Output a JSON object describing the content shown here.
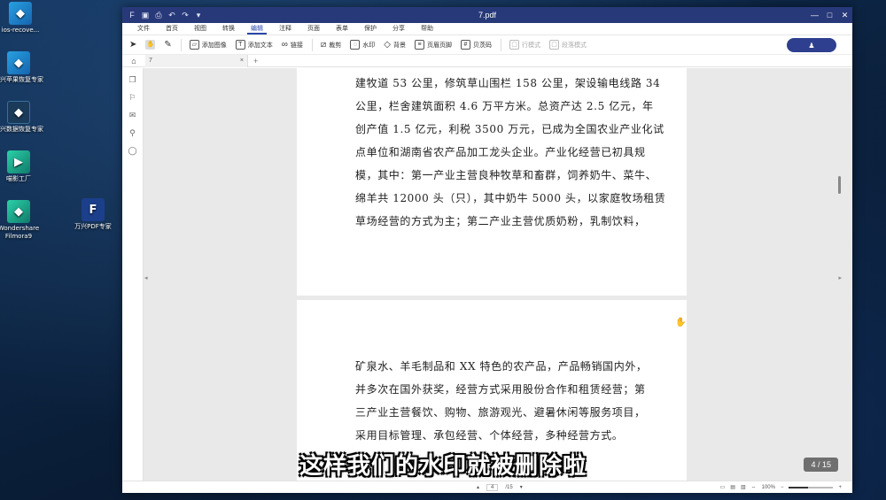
{
  "desktop": {
    "icons": [
      {
        "label": "ios-recove...",
        "glyph": "◆"
      },
      {
        "label": "万兴苹果恢复专家",
        "glyph": "◆"
      },
      {
        "label": "万兴数据恢复专家",
        "glyph": "◆"
      },
      {
        "label": "喵影工厂",
        "glyph": "▶"
      },
      {
        "label": "Wondershare Filmora9",
        "glyph": "◆"
      },
      {
        "label": "万兴PDF专家",
        "glyph": "F"
      }
    ]
  },
  "window": {
    "title": "7.pdf",
    "quick_icons": [
      "F",
      "▣",
      "⎙",
      "↶",
      "↷",
      "▾"
    ],
    "controls": [
      "—",
      "□",
      "✕"
    ]
  },
  "menu": {
    "items": [
      "文件",
      "首页",
      "视图",
      "转换",
      "编辑",
      "注释",
      "页面",
      "表单",
      "保护",
      "分享",
      "帮助"
    ],
    "active": "编辑"
  },
  "toolbar": {
    "select_icon": "➤",
    "hand_icon": "✋",
    "edit_icon": "✎",
    "add_image": "添加图像",
    "add_text": "添加文本",
    "link": "链接",
    "crop": "裁剪",
    "watermark": "水印",
    "background": "背景",
    "header_footer": "页眉页脚",
    "bates": "贝茨码",
    "line_mode": "行模式",
    "paragraph_mode": "段落模式",
    "user_icon": "♟"
  },
  "tabs": {
    "home_icon": "⌂",
    "doc_tab": "7",
    "close": "×",
    "add": "+"
  },
  "side_rail": [
    "❐",
    "⚐",
    "✉",
    "⚲",
    "◯"
  ],
  "page1": {
    "lines": [
      "建牧道 53 公里，修筑草山围栏 158 公里，架设输电线路 34",
      "公里，栏舍建筑面积 4.6 万平方米。总资产达 2.5 亿元，年",
      "创产值 1.5 亿元，利税 3500 万元，已成为全国农业产业化试",
      "点单位和湖南省农产品加工龙头企业。产业化经营已初具规",
      "模，其中：第一产业主营良种牧草和畜群，饲养奶牛、菜牛、",
      "绵羊共 12000 头（只），其中奶牛 5000 头，以家庭牧场租赁",
      "草场经营的方式为主；第二产业主营优质奶粉，乳制饮料，"
    ]
  },
  "page2": {
    "lines": [
      "矿泉水、羊毛制品和 XX 特色的农产品，产品畅销国内外，",
      "并多次在国外获奖，经营方式采用股份合作和租赁经营；第",
      "三产业主营餐饮、购物、旅游观光、避暑休闲等服务项目，",
      "采用目标管理、承包经营、个体经营，多种经营方式。"
    ]
  },
  "page_badge": "4 / 15",
  "status": {
    "page_input": "4",
    "page_total": "/15",
    "zoom": "100%"
  },
  "subtitle": "这样我们的水印就被删除啦"
}
